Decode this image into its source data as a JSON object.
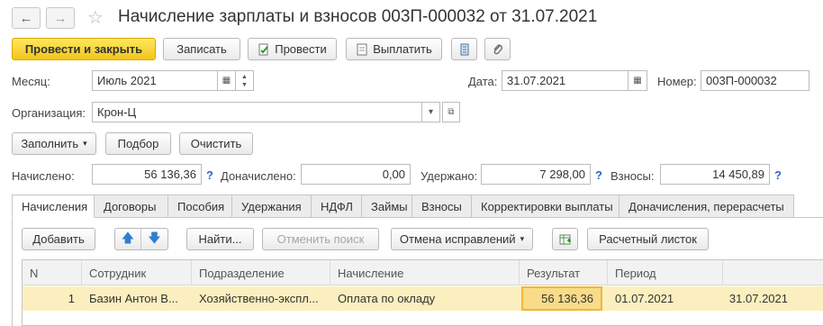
{
  "nav": {
    "back": "←",
    "forward": "→"
  },
  "document": {
    "title": "Начисление зарплаты и взносов 003П-000032 от 31.07.2021"
  },
  "toolbar": {
    "post_and_close": "Провести и закрыть",
    "save": "Записать",
    "post": "Провести",
    "pay": "Выплатить"
  },
  "header": {
    "month_label": "Месяц:",
    "month_value": "Июль 2021",
    "date_label": "Дата:",
    "date_value": "31.07.2021",
    "number_label": "Номер:",
    "number_value": "003П-000032",
    "org_label": "Организация:",
    "org_value": "Крон-Ц"
  },
  "actions": {
    "fill": "Заполнить",
    "select": "Подбор",
    "clear": "Очистить"
  },
  "totals": {
    "accrued_label": "Начислено:",
    "accrued_value": "56 136,36",
    "additional_label": "Доначислено:",
    "additional_value": "0,00",
    "withheld_label": "Удержано:",
    "withheld_value": "7 298,00",
    "contributions_label": "Взносы:",
    "contributions_value": "14 450,89",
    "help": "?"
  },
  "tabs": [
    "Начисления",
    "Договоры",
    "Пособия",
    "Удержания",
    "НДФЛ",
    "Займы",
    "Взносы",
    "Корректировки выплаты",
    "Доначисления, перерасчеты"
  ],
  "table_toolbar": {
    "add": "Добавить",
    "find": "Найти...",
    "cancel_search": "Отменить поиск",
    "cancel_corrections": "Отмена исправлений",
    "payslip": "Расчетный листок"
  },
  "table": {
    "columns": [
      "N",
      "Сотрудник",
      "Подразделение",
      "Начисление",
      "Результат",
      "Период",
      ""
    ],
    "rows": [
      [
        "1",
        "Базин Антон В...",
        "Хозяйственно-экспл...",
        "Оплата по окладу",
        "56 136,36",
        "01.07.2021",
        "31.07.2021"
      ]
    ]
  },
  "colors": {
    "primary_button": "#f2c51a",
    "selected_row": "#fbefbf",
    "help_blue": "#2a66c9"
  }
}
